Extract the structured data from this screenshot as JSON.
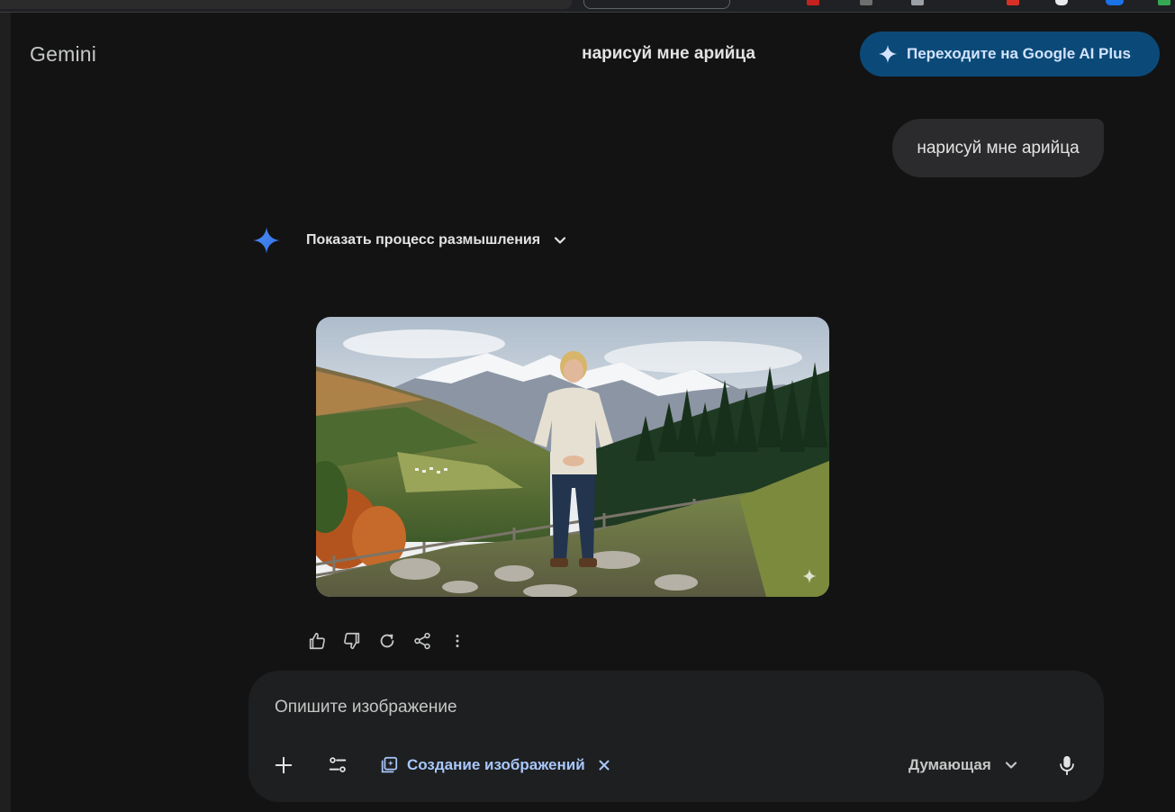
{
  "app": {
    "brand": "Gemini"
  },
  "header": {
    "conversation_title": "нарисуй мне арийца",
    "upgrade_label": "Переходите на Google AI Plus"
  },
  "chat": {
    "user_message": "нарисуй мне арийца",
    "thinking_toggle_label": "Показать процесс размышления"
  },
  "composer": {
    "placeholder": "Опишите изображение",
    "tool_chip_label": "Создание изображений",
    "model_label": "Думающая"
  },
  "colors": {
    "background": "#131314",
    "accent": "#a8c7fa",
    "upgrade_bg": "#0b4a78",
    "spark_blue": "#4f8df7"
  },
  "icons": [
    "sparkle-icon",
    "chevron-down-icon",
    "thumbs-up-icon",
    "thumbs-down-icon",
    "regenerate-icon",
    "share-icon",
    "more-vert-icon",
    "plus-icon",
    "tune-icon",
    "image-gen-icon",
    "close-icon",
    "mic-icon"
  ]
}
